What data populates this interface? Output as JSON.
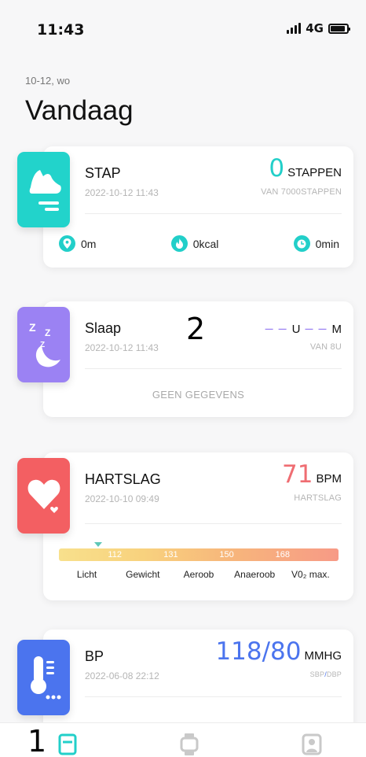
{
  "status": {
    "time": "11:43",
    "network": "4G"
  },
  "header": {
    "date": "10-12, wo",
    "title": "Vandaag"
  },
  "cards": {
    "steps": {
      "title": "STAP",
      "date": "2022-10-12 11:43",
      "value": "0",
      "unit": "STAPPEN",
      "sub": "VAN 7000STAPPEN",
      "stats": [
        {
          "icon": "location-pin-icon",
          "value": "0m"
        },
        {
          "icon": "flame-icon",
          "value": "0kcal"
        },
        {
          "icon": "clock-icon",
          "value": "0min"
        }
      ],
      "accent": "#22cfc9"
    },
    "sleep": {
      "title": "Slaap",
      "date": "2022-10-12 11:43",
      "dash_hours": "– –",
      "hours_unit": "U",
      "dash_minutes": "– –",
      "minutes_unit": "M",
      "sub": "VAN 8U",
      "no_data": "GEEN GEGEVENS",
      "accent": "#9b82f3"
    },
    "heart": {
      "title": "HARTSLAG",
      "date": "2022-10-10 09:49",
      "value": "71",
      "unit": "BPM",
      "sub": "HARTSLAG",
      "zone_ticks": [
        "112",
        "131",
        "150",
        "168"
      ],
      "zones": [
        "Licht",
        "Gewicht",
        "Aeroob",
        "Anaeroob",
        "V0₂ max."
      ],
      "accent": "#f35f62"
    },
    "bp": {
      "title": "BP",
      "date": "2022-06-08 22:12",
      "value": "118/80",
      "unit": "MMHG",
      "sub_sbp": "SBP",
      "sub_sep": "/",
      "sub_dbp": "DBP",
      "accent": "#4b74ee"
    }
  },
  "annotations": {
    "one": "1",
    "two": "2"
  },
  "tabs": [
    {
      "icon": "today-icon",
      "active": true
    },
    {
      "icon": "watch-icon",
      "active": false
    },
    {
      "icon": "profile-icon",
      "active": false
    }
  ]
}
